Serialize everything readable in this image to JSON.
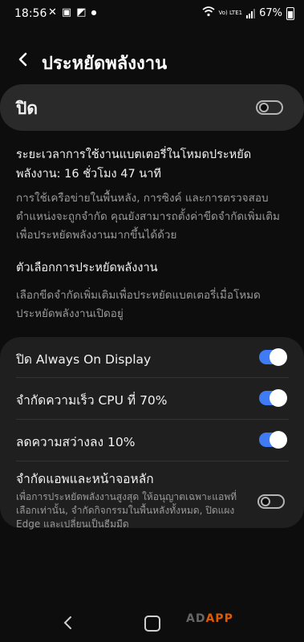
{
  "status": {
    "time": "18:56",
    "left_icons": [
      "missed-call-icon",
      "image-icon",
      "gallery-icon",
      "dot-icon"
    ],
    "network": "Vo) LTE1",
    "battery": "67%"
  },
  "header": {
    "title": "ประหยัดพลังงาน"
  },
  "master": {
    "label": "ปิด",
    "on": false
  },
  "usage_text": "ระยะเวลาการใช้งานแบตเตอรี่ในโหมดประหยัดพลังงาน: 16 ชั่วโมง 47 นาที",
  "description": "การใช้เครือข่ายในพื้นหลัง, การซิงค์ และการตรวจสอบตำแหน่งจะถูกจำกัด คุณยังสามารถตั้งค่าขีดจำกัดเพิ่มเติมเพื่อประหยัดพลังงานมากขึ้นได้ด้วย",
  "options_section": {
    "title": "ตัวเลือกการประหยัดพลังงาน",
    "description": "เลือกขีดจำกัดเพิ่มเติมเพื่อประหยัดแบตเตอรี่เมื่อโหมดประหยัดพลังงานเปิดอยู่"
  },
  "options": [
    {
      "label": "ปิด Always On Display",
      "on": true
    },
    {
      "label": "จำกัดความเร็ว CPU ที่ 70%",
      "on": true
    },
    {
      "label": "ลดความสว่างลง 10%",
      "on": true
    },
    {
      "label": "จำกัดแอพและหน้าจอหลัก",
      "sub": "เพื่อการประหยัดพลังงานสูงสุด ให้อนุญาตเฉพาะแอพที่เลือกเท่านั้น, จำกัดกิจกรรมในพื้นหลังทั้งหมด, ปิดแผง Edge และเปลี่ยนเป็นธีมมืด",
      "on": false
    }
  ],
  "watermark": {
    "prefix": "AD",
    "brand": "APP"
  },
  "colors": {
    "toggle_on": "#3e7bf5",
    "background": "#0d0d0d",
    "card": "#1f1f1f"
  }
}
